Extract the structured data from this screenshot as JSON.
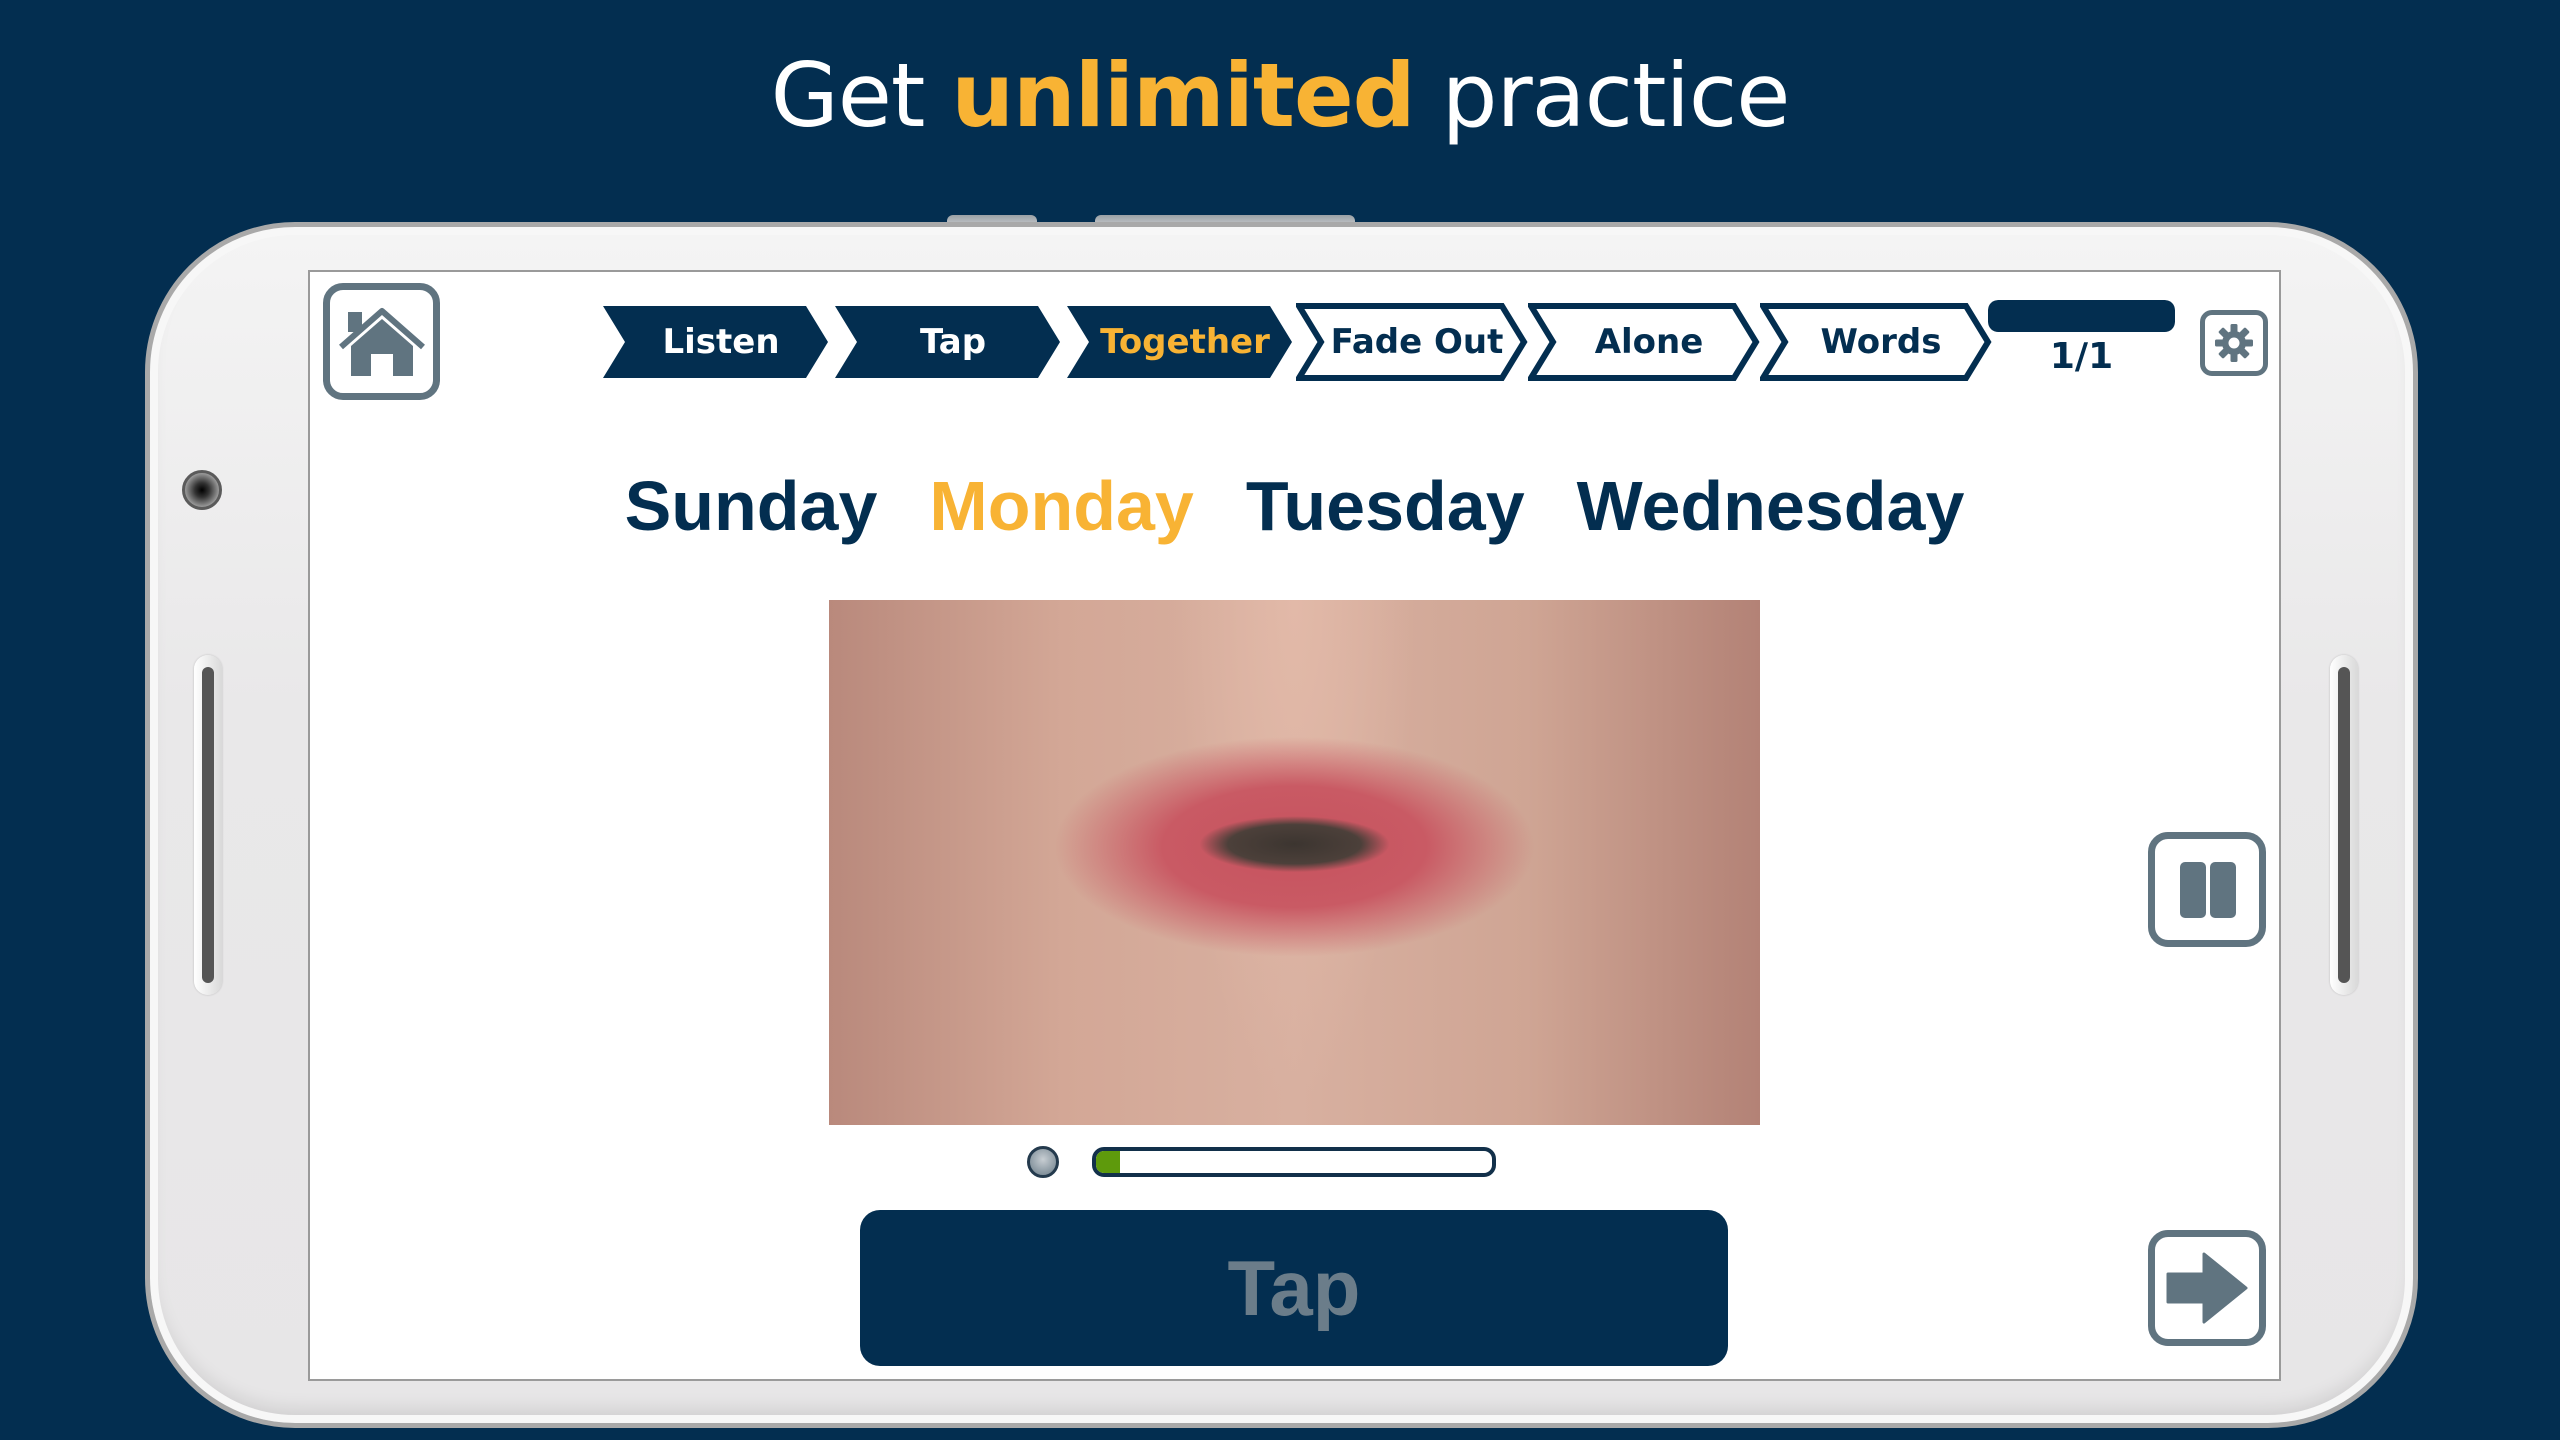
{
  "headline": {
    "prefix": "Get",
    "highlight": "unlimited",
    "suffix": "practice"
  },
  "colors": {
    "background": "#032e50",
    "accent": "#f8b334",
    "icon_gray": "#607480",
    "meter_green": "#5e9a0c"
  },
  "toolbar": {
    "home_icon": "home-icon",
    "settings_icon": "gear-icon",
    "steps": [
      {
        "label": "Listen",
        "state": "done"
      },
      {
        "label": "Tap",
        "state": "done"
      },
      {
        "label": "Together",
        "state": "current"
      },
      {
        "label": "Fade Out",
        "state": "upcoming"
      },
      {
        "label": "Alone",
        "state": "upcoming"
      },
      {
        "label": "Words",
        "state": "upcoming"
      }
    ],
    "progress": {
      "fraction": 1.0,
      "label": "1/1"
    }
  },
  "words": [
    {
      "text": "Sunday",
      "active": false
    },
    {
      "text": "Monday",
      "active": true
    },
    {
      "text": "Tuesday",
      "active": false
    },
    {
      "text": "Wednesday",
      "active": false
    }
  ],
  "video": {
    "description": "close-up of mouth speaking"
  },
  "audio_meter": {
    "level_percent": 6
  },
  "tap_button": {
    "label": "Tap"
  },
  "controls": {
    "pause_icon": "pause-icon",
    "next_icon": "arrow-right-icon"
  }
}
